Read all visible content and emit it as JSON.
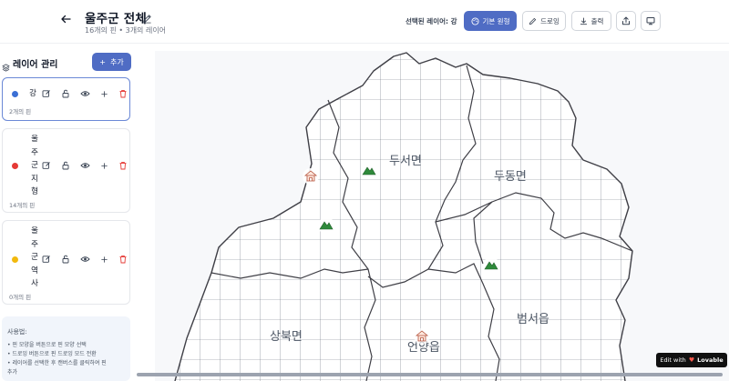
{
  "header": {
    "back_icon": "arrow-left-icon",
    "title": "울주군 전체",
    "subtitle": "16개의 핀 • 3개의 레이어",
    "selected_layer_text": "선택된 레이어: 강",
    "buttons": {
      "basic_shape": "기본 원형",
      "draw": "드로잉",
      "export": "출력"
    }
  },
  "sidebar": {
    "title": "레이어 관리",
    "add_label": "추가",
    "layers": [
      {
        "name": "강",
        "pins": "2개의 핀",
        "color": "#3b6fd4",
        "selected": true
      },
      {
        "name": "울주군지형",
        "pins": "14개의 핀",
        "color": "#e53935",
        "selected": false
      },
      {
        "name": "울주군역사",
        "pins": "0개의 핀",
        "color": "#f2b90d",
        "selected": false
      }
    ],
    "usage": {
      "title": "사용법:",
      "items": [
        "• 핀 모양을 버튼으로 핀 모양 선택",
        "• 드로잉 버튼으로 핀 드로잉 모드 전환",
        "• 레이어를 선택한 후 캔버스를 클릭하여 핀",
        "추가"
      ]
    }
  },
  "map": {
    "regions": [
      "두서면",
      "두동면",
      "상북면",
      "언양읍",
      "범서읍"
    ],
    "marker_icons": [
      "mountain-icon",
      "temple-icon"
    ]
  },
  "badge": {
    "text": "Edit with",
    "brand": "Lovable"
  },
  "colors": {
    "primary": "#4f6cc4",
    "selected_border": "#6b89d6"
  }
}
